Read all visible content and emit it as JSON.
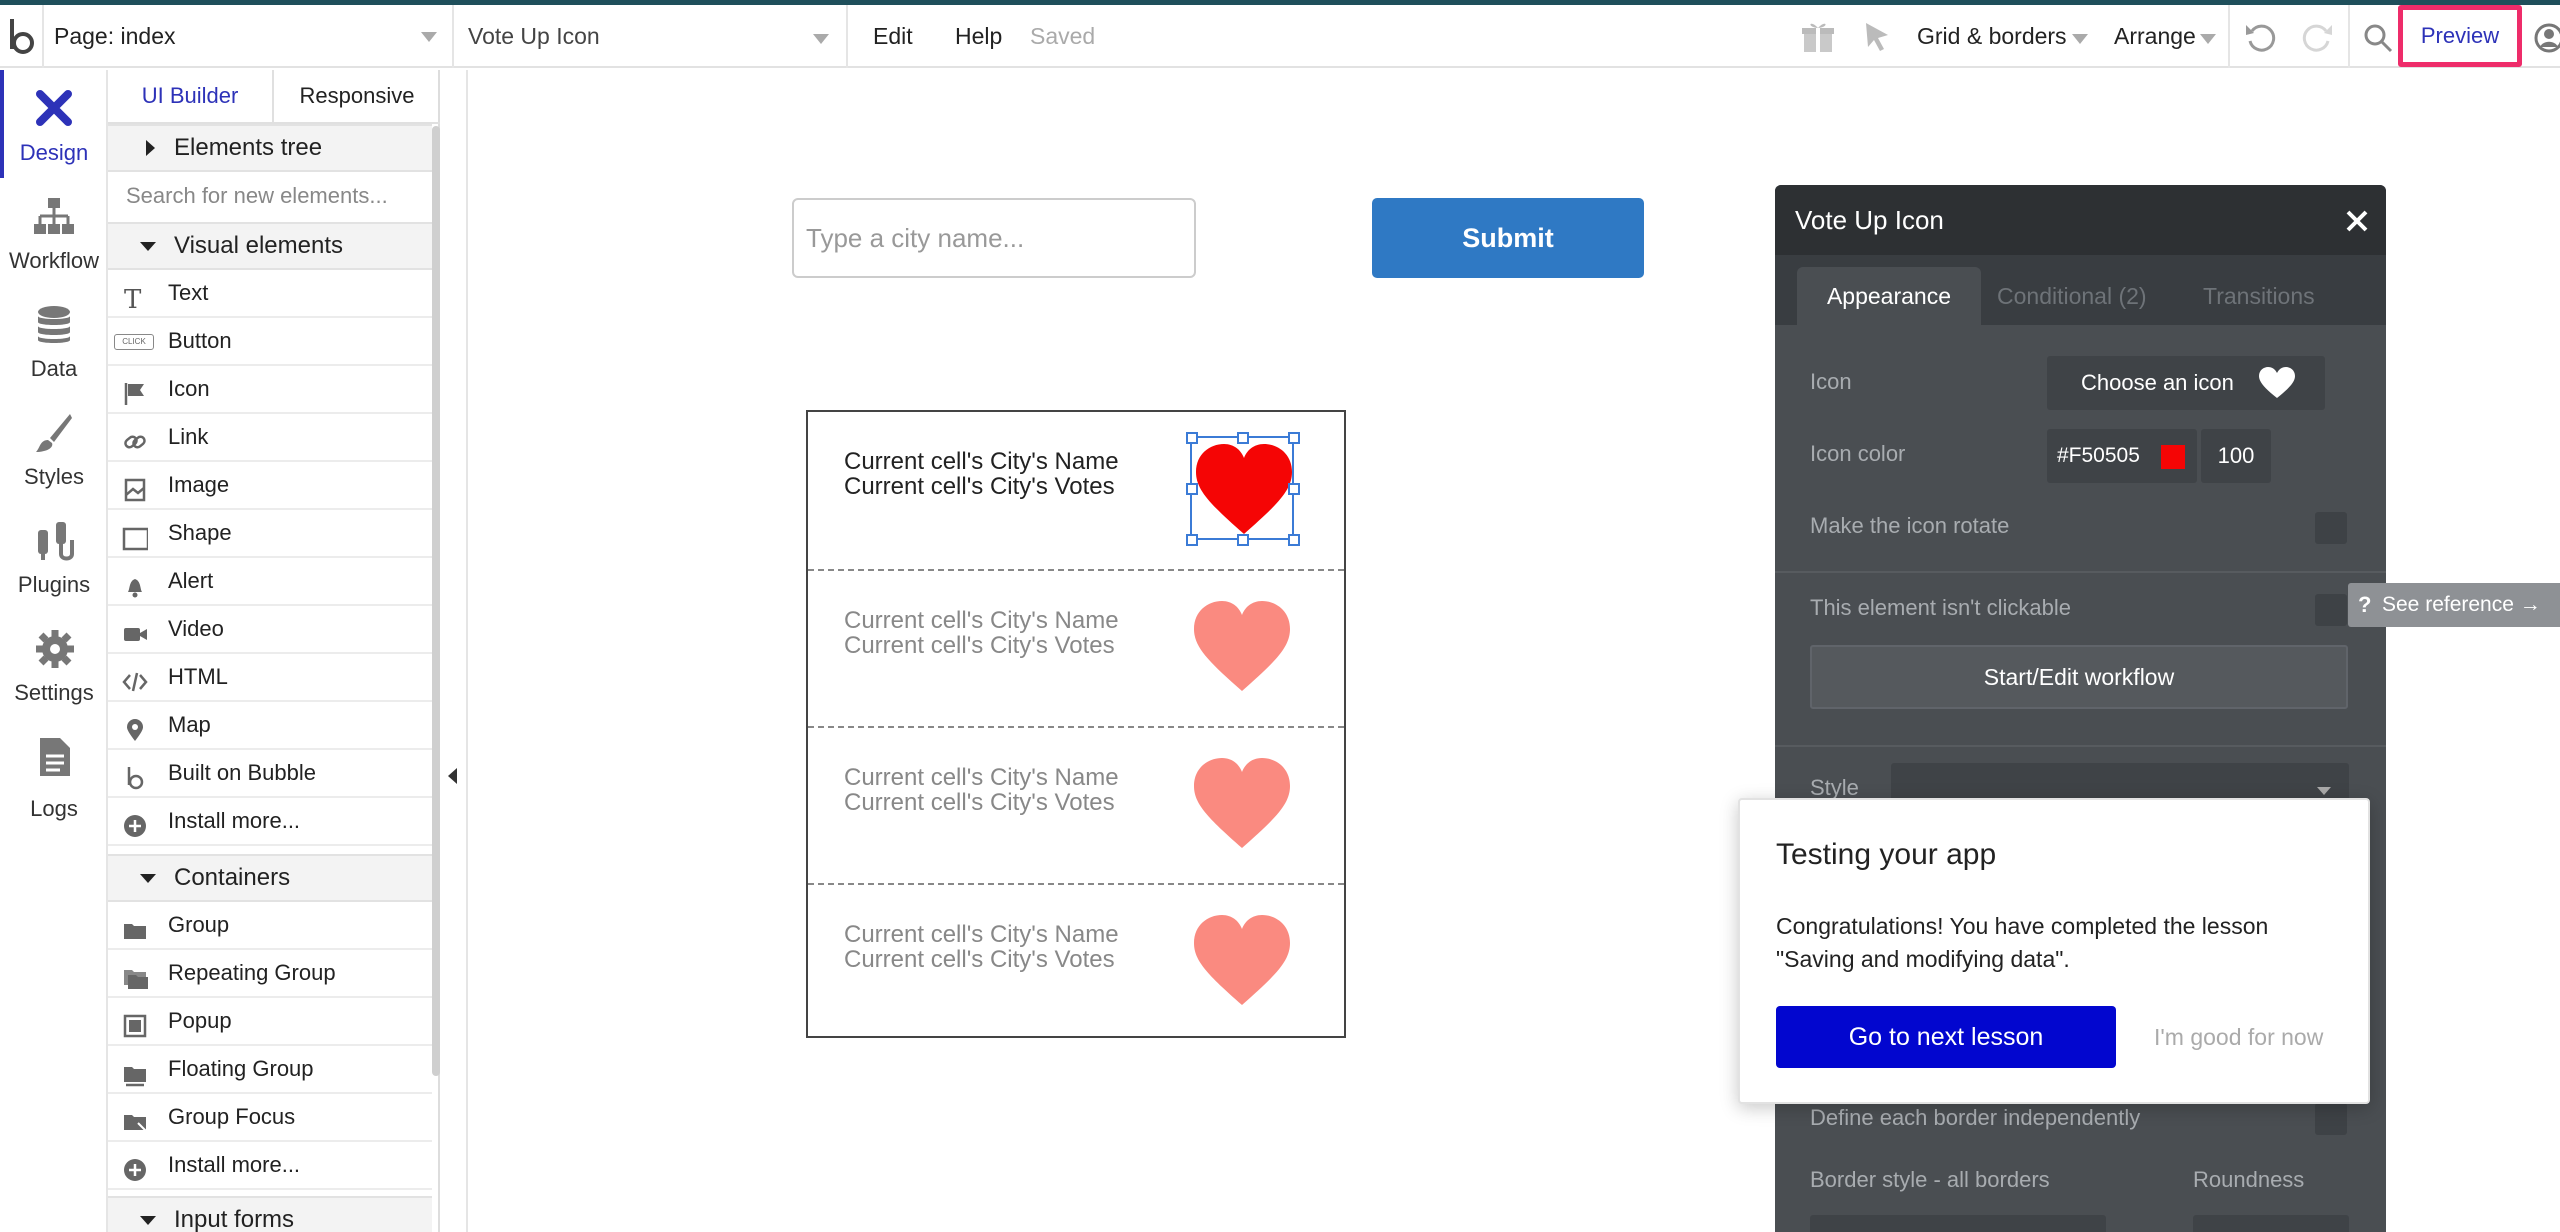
{
  "topbar": {
    "page_selector": "Page: index",
    "element_selector": "Vote Up Icon",
    "menu_edit": "Edit",
    "menu_help": "Help",
    "save_status": "Saved",
    "grid_borders": "Grid & borders",
    "arrange": "Arrange",
    "preview": "Preview"
  },
  "left_tabs": [
    {
      "label": "Design"
    },
    {
      "label": "Workflow"
    },
    {
      "label": "Data"
    },
    {
      "label": "Styles"
    },
    {
      "label": "Plugins"
    },
    {
      "label": "Settings"
    },
    {
      "label": "Logs"
    }
  ],
  "palette": {
    "tab_ui_builder": "UI Builder",
    "tab_responsive": "Responsive",
    "elements_tree": "Elements tree",
    "search_placeholder": "Search for new elements...",
    "section_visual": "Visual elements",
    "visual_items": [
      {
        "label": "Text",
        "icon": "text-icon"
      },
      {
        "label": "Button",
        "icon": "button-icon"
      },
      {
        "label": "Icon",
        "icon": "flag-icon"
      },
      {
        "label": "Link",
        "icon": "link-icon"
      },
      {
        "label": "Image",
        "icon": "image-icon"
      },
      {
        "label": "Shape",
        "icon": "shape-icon"
      },
      {
        "label": "Alert",
        "icon": "bell-icon"
      },
      {
        "label": "Video",
        "icon": "video-icon"
      },
      {
        "label": "HTML",
        "icon": "code-icon"
      },
      {
        "label": "Map",
        "icon": "map-pin-icon"
      },
      {
        "label": "Built on Bubble",
        "icon": "bubble-logo-icon"
      },
      {
        "label": "Install more...",
        "icon": "plus-circle-icon"
      }
    ],
    "button_badge": "CLICK",
    "section_containers": "Containers",
    "container_items": [
      {
        "label": "Group",
        "icon": "folder-icon"
      },
      {
        "label": "Repeating Group",
        "icon": "repeating-group-icon"
      },
      {
        "label": "Popup",
        "icon": "popup-icon"
      },
      {
        "label": "Floating Group",
        "icon": "floating-group-icon"
      },
      {
        "label": "Group Focus",
        "icon": "group-focus-icon"
      },
      {
        "label": "Install more...",
        "icon": "plus-circle-icon"
      }
    ],
    "section_inputs": "Input forms"
  },
  "canvas": {
    "city_input_placeholder": "Type a city name...",
    "submit_label": "Submit",
    "rows": [
      {
        "name": "Current cell's City's Name",
        "votes": "Current cell's City's Votes",
        "heart_color": "#F50505"
      },
      {
        "name": "Current cell's City's Name",
        "votes": "Current cell's City's Votes",
        "heart_color": "#FA8A80"
      },
      {
        "name": "Current cell's City's Name",
        "votes": "Current cell's City's Votes",
        "heart_color": "#FA8A80"
      },
      {
        "name": "Current cell's City's Name",
        "votes": "Current cell's City's Votes",
        "heart_color": "#FA8A80"
      }
    ]
  },
  "props": {
    "title": "Vote Up Icon",
    "tabs": [
      "Appearance",
      "Conditional (2)",
      "Transitions"
    ],
    "icon_label": "Icon",
    "choose_icon": "Choose an icon",
    "icon_color_label": "Icon color",
    "icon_color_hex": "#F50505",
    "icon_opacity": "100",
    "rotate_label": "Make the icon rotate",
    "not_clickable_label": "This element isn't clickable",
    "workflow_button": "Start/Edit workflow",
    "style_label": "Style",
    "border_independent_label": "Define each border independently",
    "border_style_label": "Border style - all borders",
    "roundness_label": "Roundness"
  },
  "see_reference": "See reference →",
  "modal": {
    "title": "Testing your app",
    "body": "Congratulations! You have completed the lesson \"Saving and modifying data\".",
    "primary": "Go to next lesson",
    "secondary": "I'm good for now"
  }
}
